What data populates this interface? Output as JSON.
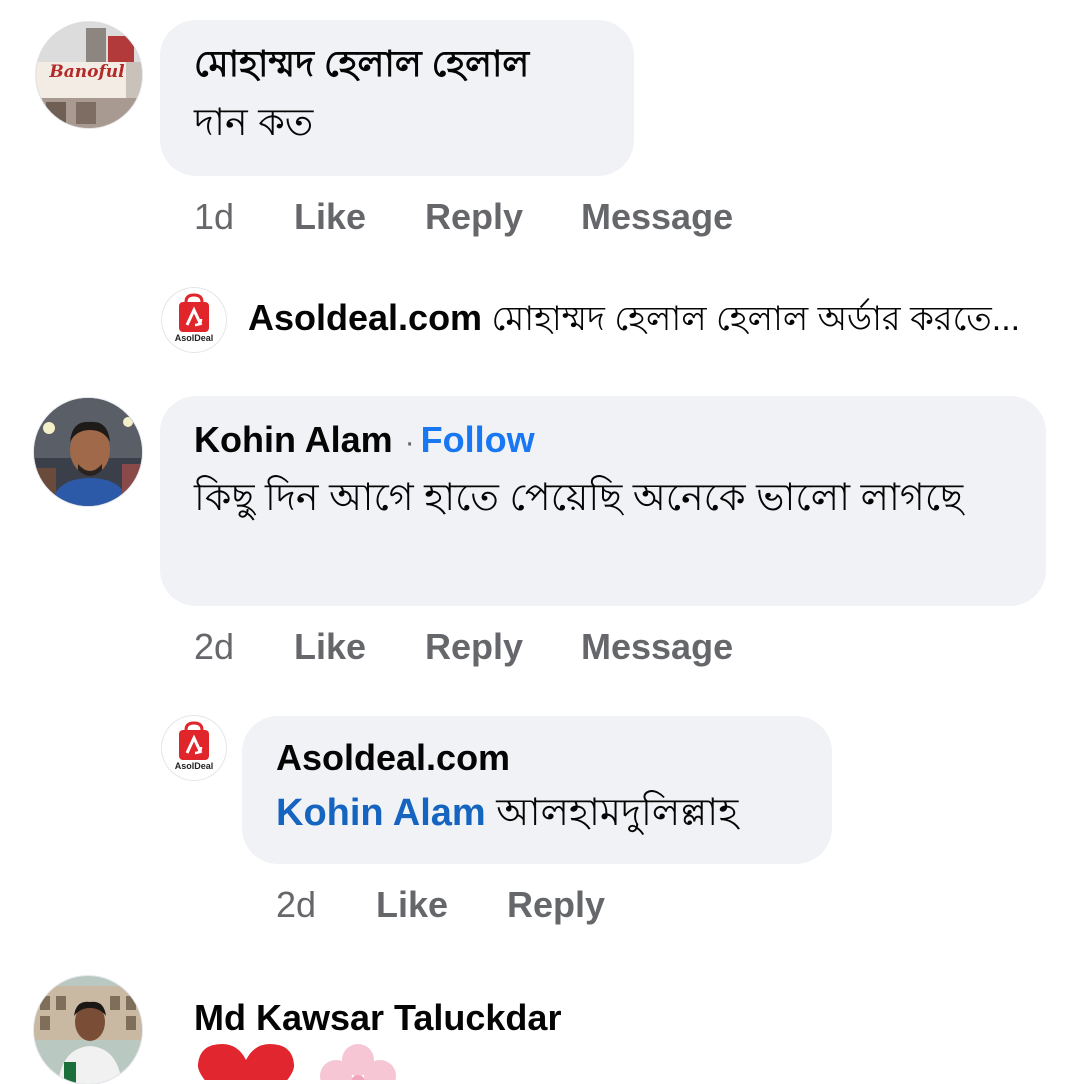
{
  "comments": [
    {
      "author": "মোহাম্মদ হেলাল হেলাল",
      "text": "দান কত",
      "avatar": "Banoful",
      "actions": {
        "time": "1d",
        "like": "Like",
        "reply": "Reply",
        "message": "Message"
      }
    },
    {
      "author": "Kohin Alam",
      "follow": "Follow",
      "text": "কিছু দিন আগে হাতে পেয়েছি অনেকে ভালো লাগছে",
      "actions": {
        "time": "2d",
        "like": "Like",
        "reply": "Reply",
        "message": "Message"
      }
    },
    {
      "author": "Md Kawsar Taluckdar"
    }
  ],
  "replies": [
    {
      "author": "Asoldeal.com",
      "logo_text": "AsolDeal",
      "preview": "মোহাম্মদ হেলাল হেলাল অর্ডার করতে..."
    },
    {
      "author": "Asoldeal.com",
      "logo_text": "AsolDeal",
      "mention": "Kohin Alam",
      "text": "আলহামদুলিল্লাহ",
      "actions": {
        "time": "2d",
        "like": "Like",
        "reply": "Reply"
      }
    }
  ],
  "colors": {
    "bubble": "#f0f2f5",
    "action_text": "#65676b",
    "follow": "#1877f2",
    "mention": "#1565c0",
    "brand_red": "#e0252b"
  }
}
